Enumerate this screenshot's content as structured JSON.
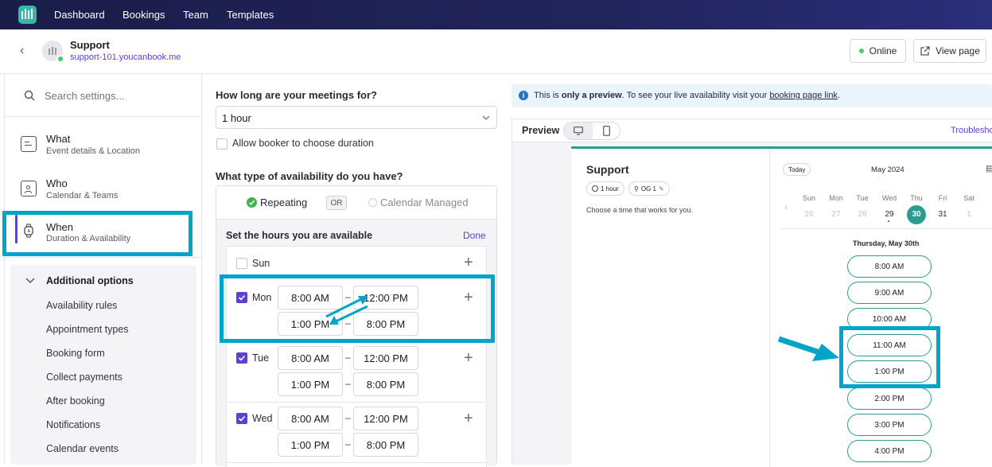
{
  "topnav": {
    "items": [
      "Dashboard",
      "Bookings",
      "Team",
      "Templates"
    ]
  },
  "header": {
    "title": "Support",
    "url": "support-101.youcanbook.me",
    "online_label": "Online",
    "view_page_label": "View page"
  },
  "sidebar": {
    "search_placeholder": "Search settings...",
    "sections": [
      {
        "title": "What",
        "sub": "Event details & Location"
      },
      {
        "title": "Who",
        "sub": "Calendar & Teams"
      },
      {
        "title": "When",
        "sub": "Duration & Availability"
      }
    ],
    "additional_label": "Additional options",
    "sub_items": [
      "Availability rules",
      "Appointment types",
      "Booking form",
      "Collect payments",
      "After booking",
      "Notifications",
      "Calendar events"
    ]
  },
  "middle": {
    "duration_question": "How long are your meetings for?",
    "duration_value": "1 hour",
    "allow_choose_label": "Allow booker to choose duration",
    "availability_question": "What type of availability do you have?",
    "repeating_label": "Repeating",
    "or_label": "OR",
    "calendar_managed_label": "Calendar Managed",
    "hours_title": "Set the hours you are available",
    "done_label": "Done",
    "days": [
      {
        "name": "Sun",
        "checked": false,
        "ranges": []
      },
      {
        "name": "Mon",
        "checked": true,
        "ranges": [
          [
            "8:00 AM",
            "12:00 PM"
          ],
          [
            "1:00 PM",
            "8:00 PM"
          ]
        ]
      },
      {
        "name": "Tue",
        "checked": true,
        "ranges": [
          [
            "8:00 AM",
            "12:00 PM"
          ],
          [
            "1:00 PM",
            "8:00 PM"
          ]
        ]
      },
      {
        "name": "Wed",
        "checked": true,
        "ranges": [
          [
            "8:00 AM",
            "12:00 PM"
          ],
          [
            "1:00 PM",
            "8:00 PM"
          ]
        ]
      }
    ],
    "range_separator": "–"
  },
  "preview": {
    "notice_prefix": "This is ",
    "notice_bold": "only a preview",
    "notice_middle": ". To see your live availability visit your ",
    "notice_link": "booking page link",
    "notice_end": ".",
    "preview_label": "Preview",
    "troubleshoot_label": "Troublesho",
    "card_title": "Support",
    "duration_chip": "1 hour",
    "host_chip": "OG 1",
    "choose_time_text": "Choose a time that works for you.",
    "today_label": "Today",
    "month_label": "May 2024",
    "weekdays": [
      "Sun",
      "Mon",
      "Tue",
      "Wed",
      "Thu",
      "Fri",
      "Sat"
    ],
    "dates": [
      "26",
      "27",
      "28",
      "29",
      "30",
      "31",
      "1"
    ],
    "selected_date_label": "Thursday, May 30th",
    "slots": [
      "8:00 AM",
      "9:00 AM",
      "10:00 AM",
      "11:00 AM",
      "1:00 PM",
      "2:00 PM",
      "3:00 PM",
      "4:00 PM"
    ]
  },
  "colors": {
    "accent": "#5d3fd3",
    "teal": "#2a9d8f",
    "highlight": "#00a4c9",
    "nav": "#1a1d4a"
  }
}
